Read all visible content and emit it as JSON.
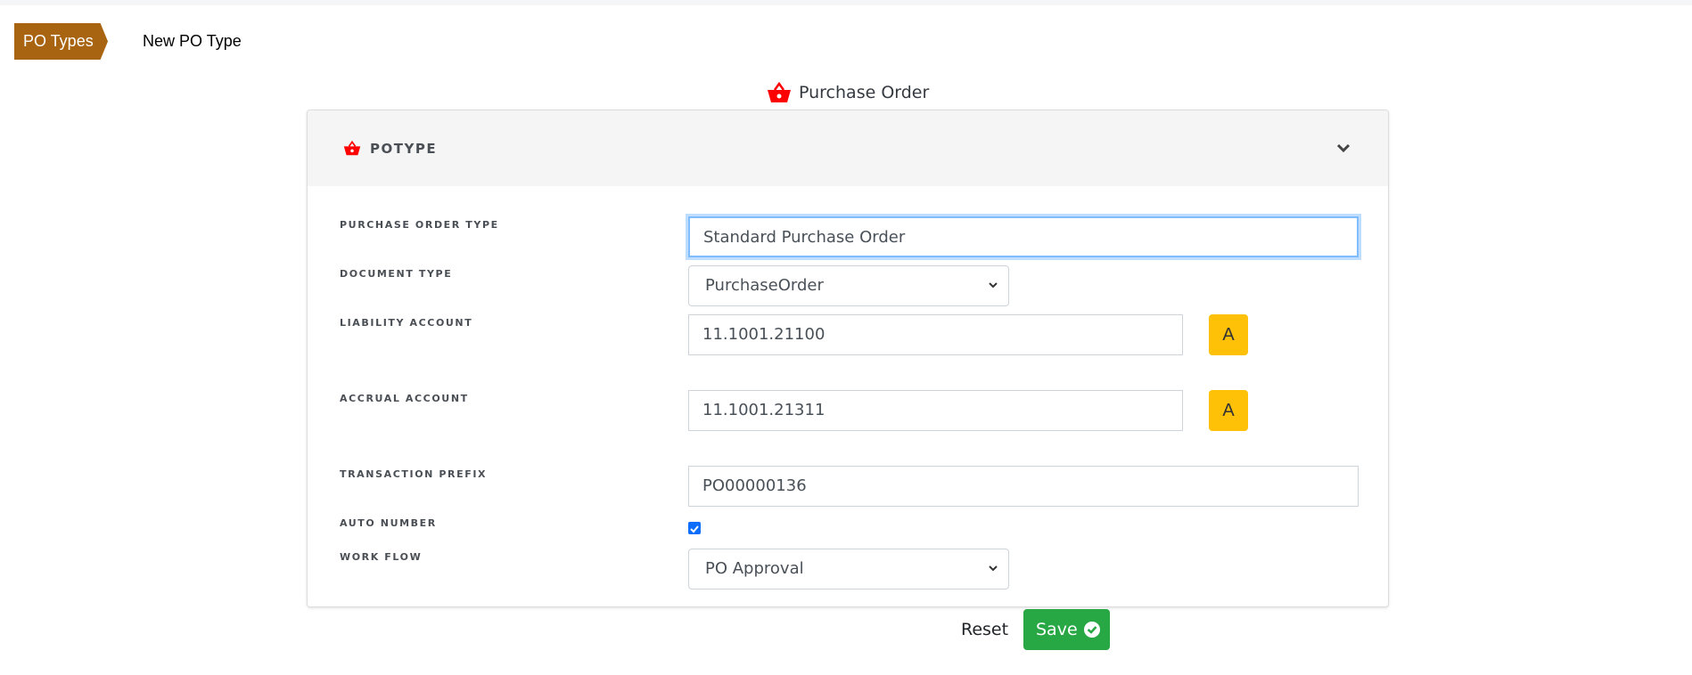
{
  "breadcrumb": {
    "parent": "PO Types",
    "current": "New PO Type"
  },
  "page_title": "Purchase Order",
  "card": {
    "title": "POTYPE"
  },
  "fields": {
    "po_type": {
      "label": "PURCHASE ORDER TYPE",
      "value": "Standard Purchase Order"
    },
    "doc_type": {
      "label": "DOCUMENT TYPE",
      "value": "PurchaseOrder"
    },
    "liability": {
      "label": "LIABILITY ACCOUNT",
      "value": "11.1001.21100",
      "btn": "A"
    },
    "accrual": {
      "label": "ACCRUAL ACCOUNT",
      "value": "11.1001.21311",
      "btn": "A"
    },
    "prefix": {
      "label": "TRANSACTION PREFIX",
      "value": "PO00000136"
    },
    "auto": {
      "label": "AUTO NUMBER",
      "checked": true
    },
    "workflow": {
      "label": "WORK FLOW",
      "value": "PO Approval"
    }
  },
  "actions": {
    "reset": "Reset",
    "save": "Save"
  },
  "colors": {
    "breadcrumb": "#a86411",
    "accent_icon": "#ff0000",
    "lookup": "#ffc107",
    "save": "#28a745"
  }
}
